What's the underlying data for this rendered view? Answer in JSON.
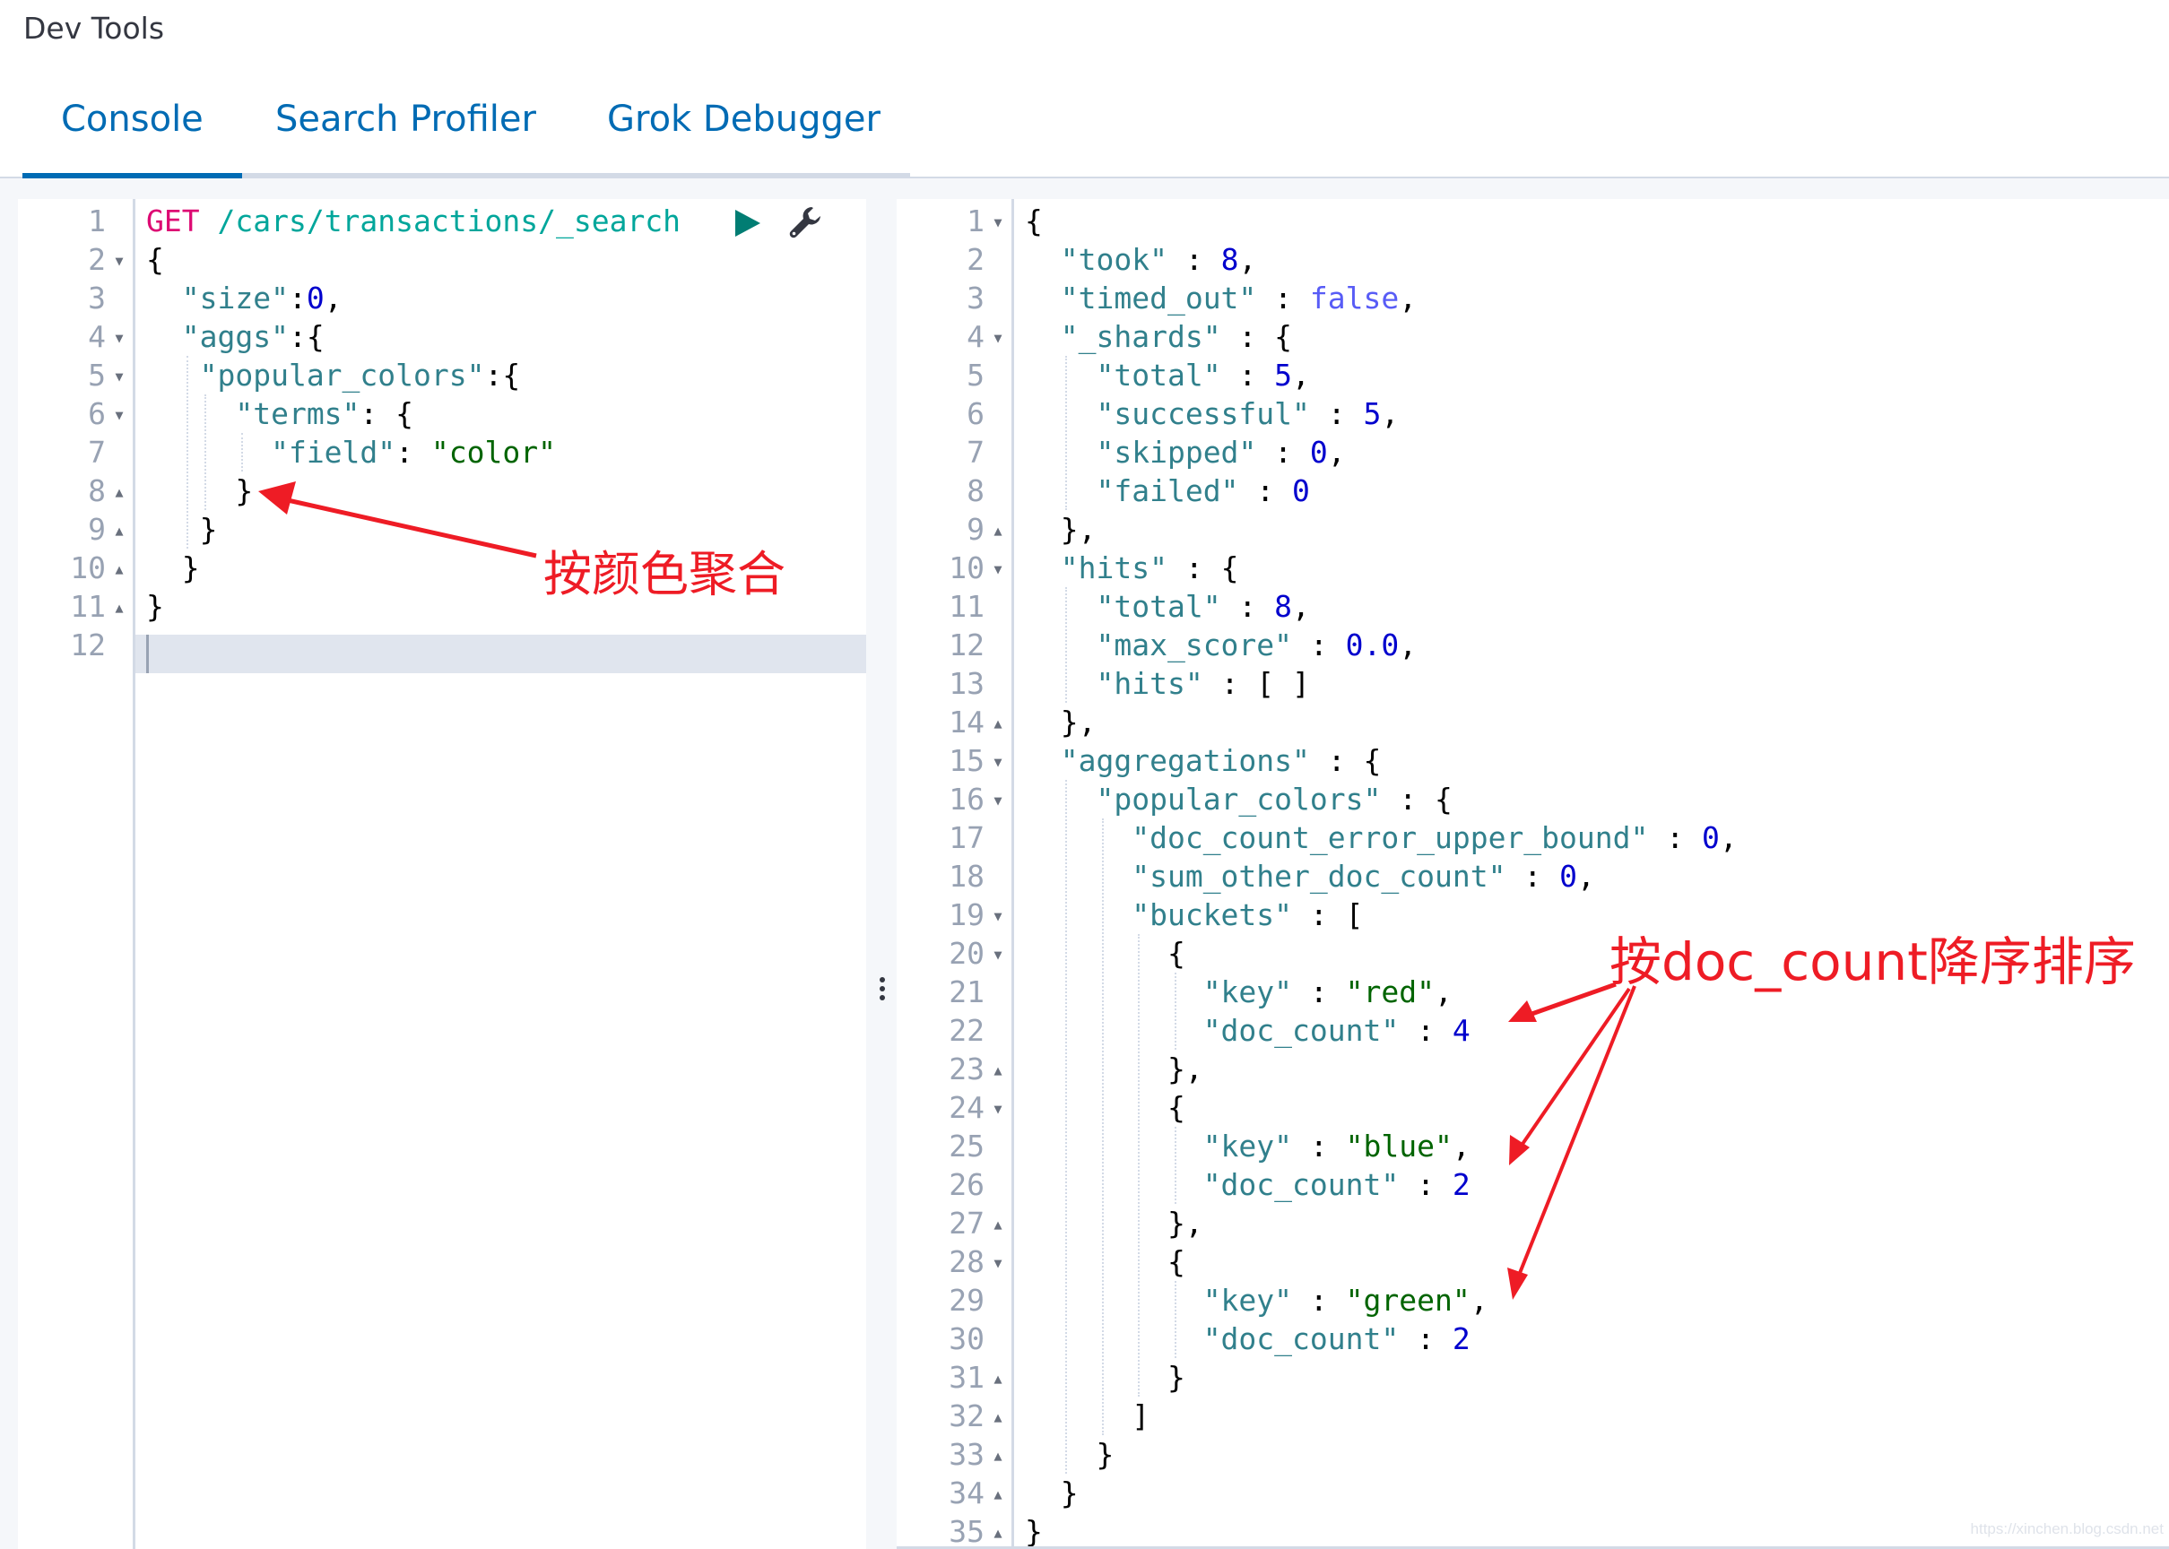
{
  "app": {
    "title": "Dev Tools"
  },
  "tabs": [
    {
      "label": "Console",
      "active": true
    },
    {
      "label": "Search Profiler",
      "active": false
    },
    {
      "label": "Grok Debugger",
      "active": false
    }
  ],
  "request_editor": {
    "active_line": 12,
    "actions": {
      "run_icon": "play-icon",
      "settings_icon": "wrench-icon"
    },
    "lines": [
      {
        "n": 1,
        "fold": "",
        "tokens": [
          [
            "method",
            "GET"
          ],
          [
            "punc",
            " "
          ],
          [
            "url",
            "/cars/transactions/_search"
          ]
        ]
      },
      {
        "n": 2,
        "fold": "open",
        "tokens": [
          [
            "punc",
            "{"
          ]
        ]
      },
      {
        "n": 3,
        "fold": "",
        "tokens": [
          [
            "punc",
            "  "
          ],
          [
            "key",
            "\"size\""
          ],
          [
            "punc",
            ":"
          ],
          [
            "num",
            "0"
          ],
          [
            "punc",
            ","
          ]
        ]
      },
      {
        "n": 4,
        "fold": "open",
        "tokens": [
          [
            "punc",
            "  "
          ],
          [
            "key",
            "\"aggs\""
          ],
          [
            "punc",
            ":{"
          ]
        ]
      },
      {
        "n": 5,
        "fold": "open",
        "tokens": [
          [
            "punc",
            "   "
          ],
          [
            "key",
            "\"popular_colors\""
          ],
          [
            "punc",
            ":{"
          ]
        ]
      },
      {
        "n": 6,
        "fold": "open",
        "tokens": [
          [
            "punc",
            "     "
          ],
          [
            "key",
            "\"terms\""
          ],
          [
            "punc",
            ": {"
          ]
        ]
      },
      {
        "n": 7,
        "fold": "",
        "tokens": [
          [
            "punc",
            "       "
          ],
          [
            "key",
            "\"field\""
          ],
          [
            "punc",
            ": "
          ],
          [
            "str",
            "\"color\""
          ]
        ]
      },
      {
        "n": 8,
        "fold": "close",
        "tokens": [
          [
            "punc",
            "     }"
          ]
        ]
      },
      {
        "n": 9,
        "fold": "close",
        "tokens": [
          [
            "punc",
            "   }"
          ]
        ]
      },
      {
        "n": 10,
        "fold": "close",
        "tokens": [
          [
            "punc",
            "  }"
          ]
        ]
      },
      {
        "n": 11,
        "fold": "close",
        "tokens": [
          [
            "punc",
            "}"
          ]
        ]
      },
      {
        "n": 12,
        "fold": "",
        "tokens": []
      }
    ]
  },
  "response_viewer": {
    "lines": [
      {
        "n": 1,
        "fold": "open",
        "tokens": [
          [
            "punc",
            "{"
          ]
        ]
      },
      {
        "n": 2,
        "fold": "",
        "tokens": [
          [
            "punc",
            "  "
          ],
          [
            "key",
            "\"took\""
          ],
          [
            "punc",
            " : "
          ],
          [
            "num",
            "8"
          ],
          [
            "punc",
            ","
          ]
        ]
      },
      {
        "n": 3,
        "fold": "",
        "tokens": [
          [
            "punc",
            "  "
          ],
          [
            "key",
            "\"timed_out\""
          ],
          [
            "punc",
            " : "
          ],
          [
            "bool",
            "false"
          ],
          [
            "punc",
            ","
          ]
        ]
      },
      {
        "n": 4,
        "fold": "open",
        "tokens": [
          [
            "punc",
            "  "
          ],
          [
            "key",
            "\"_shards\""
          ],
          [
            "punc",
            " : {"
          ]
        ]
      },
      {
        "n": 5,
        "fold": "",
        "tokens": [
          [
            "punc",
            "    "
          ],
          [
            "key",
            "\"total\""
          ],
          [
            "punc",
            " : "
          ],
          [
            "num",
            "5"
          ],
          [
            "punc",
            ","
          ]
        ]
      },
      {
        "n": 6,
        "fold": "",
        "tokens": [
          [
            "punc",
            "    "
          ],
          [
            "key",
            "\"successful\""
          ],
          [
            "punc",
            " : "
          ],
          [
            "num",
            "5"
          ],
          [
            "punc",
            ","
          ]
        ]
      },
      {
        "n": 7,
        "fold": "",
        "tokens": [
          [
            "punc",
            "    "
          ],
          [
            "key",
            "\"skipped\""
          ],
          [
            "punc",
            " : "
          ],
          [
            "num",
            "0"
          ],
          [
            "punc",
            ","
          ]
        ]
      },
      {
        "n": 8,
        "fold": "",
        "tokens": [
          [
            "punc",
            "    "
          ],
          [
            "key",
            "\"failed\""
          ],
          [
            "punc",
            " : "
          ],
          [
            "num",
            "0"
          ]
        ]
      },
      {
        "n": 9,
        "fold": "close",
        "tokens": [
          [
            "punc",
            "  },"
          ]
        ]
      },
      {
        "n": 10,
        "fold": "open",
        "tokens": [
          [
            "punc",
            "  "
          ],
          [
            "key",
            "\"hits\""
          ],
          [
            "punc",
            " : {"
          ]
        ]
      },
      {
        "n": 11,
        "fold": "",
        "tokens": [
          [
            "punc",
            "    "
          ],
          [
            "key",
            "\"total\""
          ],
          [
            "punc",
            " : "
          ],
          [
            "num",
            "8"
          ],
          [
            "punc",
            ","
          ]
        ]
      },
      {
        "n": 12,
        "fold": "",
        "tokens": [
          [
            "punc",
            "    "
          ],
          [
            "key",
            "\"max_score\""
          ],
          [
            "punc",
            " : "
          ],
          [
            "num",
            "0.0"
          ],
          [
            "punc",
            ","
          ]
        ]
      },
      {
        "n": 13,
        "fold": "",
        "tokens": [
          [
            "punc",
            "    "
          ],
          [
            "key",
            "\"hits\""
          ],
          [
            "punc",
            " : [ ]"
          ]
        ]
      },
      {
        "n": 14,
        "fold": "close",
        "tokens": [
          [
            "punc",
            "  },"
          ]
        ]
      },
      {
        "n": 15,
        "fold": "open",
        "tokens": [
          [
            "punc",
            "  "
          ],
          [
            "key",
            "\"aggregations\""
          ],
          [
            "punc",
            " : {"
          ]
        ]
      },
      {
        "n": 16,
        "fold": "open",
        "tokens": [
          [
            "punc",
            "    "
          ],
          [
            "key",
            "\"popular_colors\""
          ],
          [
            "punc",
            " : {"
          ]
        ]
      },
      {
        "n": 17,
        "fold": "",
        "tokens": [
          [
            "punc",
            "      "
          ],
          [
            "key",
            "\"doc_count_error_upper_bound\""
          ],
          [
            "punc",
            " : "
          ],
          [
            "num",
            "0"
          ],
          [
            "punc",
            ","
          ]
        ]
      },
      {
        "n": 18,
        "fold": "",
        "tokens": [
          [
            "punc",
            "      "
          ],
          [
            "key",
            "\"sum_other_doc_count\""
          ],
          [
            "punc",
            " : "
          ],
          [
            "num",
            "0"
          ],
          [
            "punc",
            ","
          ]
        ]
      },
      {
        "n": 19,
        "fold": "open",
        "tokens": [
          [
            "punc",
            "      "
          ],
          [
            "key",
            "\"buckets\""
          ],
          [
            "punc",
            " : ["
          ]
        ]
      },
      {
        "n": 20,
        "fold": "open",
        "tokens": [
          [
            "punc",
            "        {"
          ]
        ]
      },
      {
        "n": 21,
        "fold": "",
        "tokens": [
          [
            "punc",
            "          "
          ],
          [
            "key",
            "\"key\""
          ],
          [
            "punc",
            " : "
          ],
          [
            "str",
            "\"red\""
          ],
          [
            "punc",
            ","
          ]
        ]
      },
      {
        "n": 22,
        "fold": "",
        "tokens": [
          [
            "punc",
            "          "
          ],
          [
            "key",
            "\"doc_count\""
          ],
          [
            "punc",
            " : "
          ],
          [
            "num",
            "4"
          ]
        ]
      },
      {
        "n": 23,
        "fold": "close",
        "tokens": [
          [
            "punc",
            "        },"
          ]
        ]
      },
      {
        "n": 24,
        "fold": "open",
        "tokens": [
          [
            "punc",
            "        {"
          ]
        ]
      },
      {
        "n": 25,
        "fold": "",
        "tokens": [
          [
            "punc",
            "          "
          ],
          [
            "key",
            "\"key\""
          ],
          [
            "punc",
            " : "
          ],
          [
            "str",
            "\"blue\""
          ],
          [
            "punc",
            ","
          ]
        ]
      },
      {
        "n": 26,
        "fold": "",
        "tokens": [
          [
            "punc",
            "          "
          ],
          [
            "key",
            "\"doc_count\""
          ],
          [
            "punc",
            " : "
          ],
          [
            "num",
            "2"
          ]
        ]
      },
      {
        "n": 27,
        "fold": "close",
        "tokens": [
          [
            "punc",
            "        },"
          ]
        ]
      },
      {
        "n": 28,
        "fold": "open",
        "tokens": [
          [
            "punc",
            "        {"
          ]
        ]
      },
      {
        "n": 29,
        "fold": "",
        "tokens": [
          [
            "punc",
            "          "
          ],
          [
            "key",
            "\"key\""
          ],
          [
            "punc",
            " : "
          ],
          [
            "str",
            "\"green\""
          ],
          [
            "punc",
            ","
          ]
        ]
      },
      {
        "n": 30,
        "fold": "",
        "tokens": [
          [
            "punc",
            "          "
          ],
          [
            "key",
            "\"doc_count\""
          ],
          [
            "punc",
            " : "
          ],
          [
            "num",
            "2"
          ]
        ]
      },
      {
        "n": 31,
        "fold": "close",
        "tokens": [
          [
            "punc",
            "        }"
          ]
        ]
      },
      {
        "n": 32,
        "fold": "close",
        "tokens": [
          [
            "punc",
            "      ]"
          ]
        ]
      },
      {
        "n": 33,
        "fold": "close",
        "tokens": [
          [
            "punc",
            "    }"
          ]
        ]
      },
      {
        "n": 34,
        "fold": "close",
        "tokens": [
          [
            "punc",
            "  }"
          ]
        ]
      },
      {
        "n": 35,
        "fold": "close",
        "tokens": [
          [
            "punc",
            "}"
          ]
        ]
      }
    ]
  },
  "annotations": {
    "left_label": "按颜色聚合",
    "right_label": "按doc_count降序排序",
    "color": "#ee1c25"
  },
  "watermark": "https://xinchen.blog.csdn.net",
  "theme": {
    "accent": "#006bb4",
    "run_button": "#017d73",
    "active_line": "#e0e5ee"
  }
}
